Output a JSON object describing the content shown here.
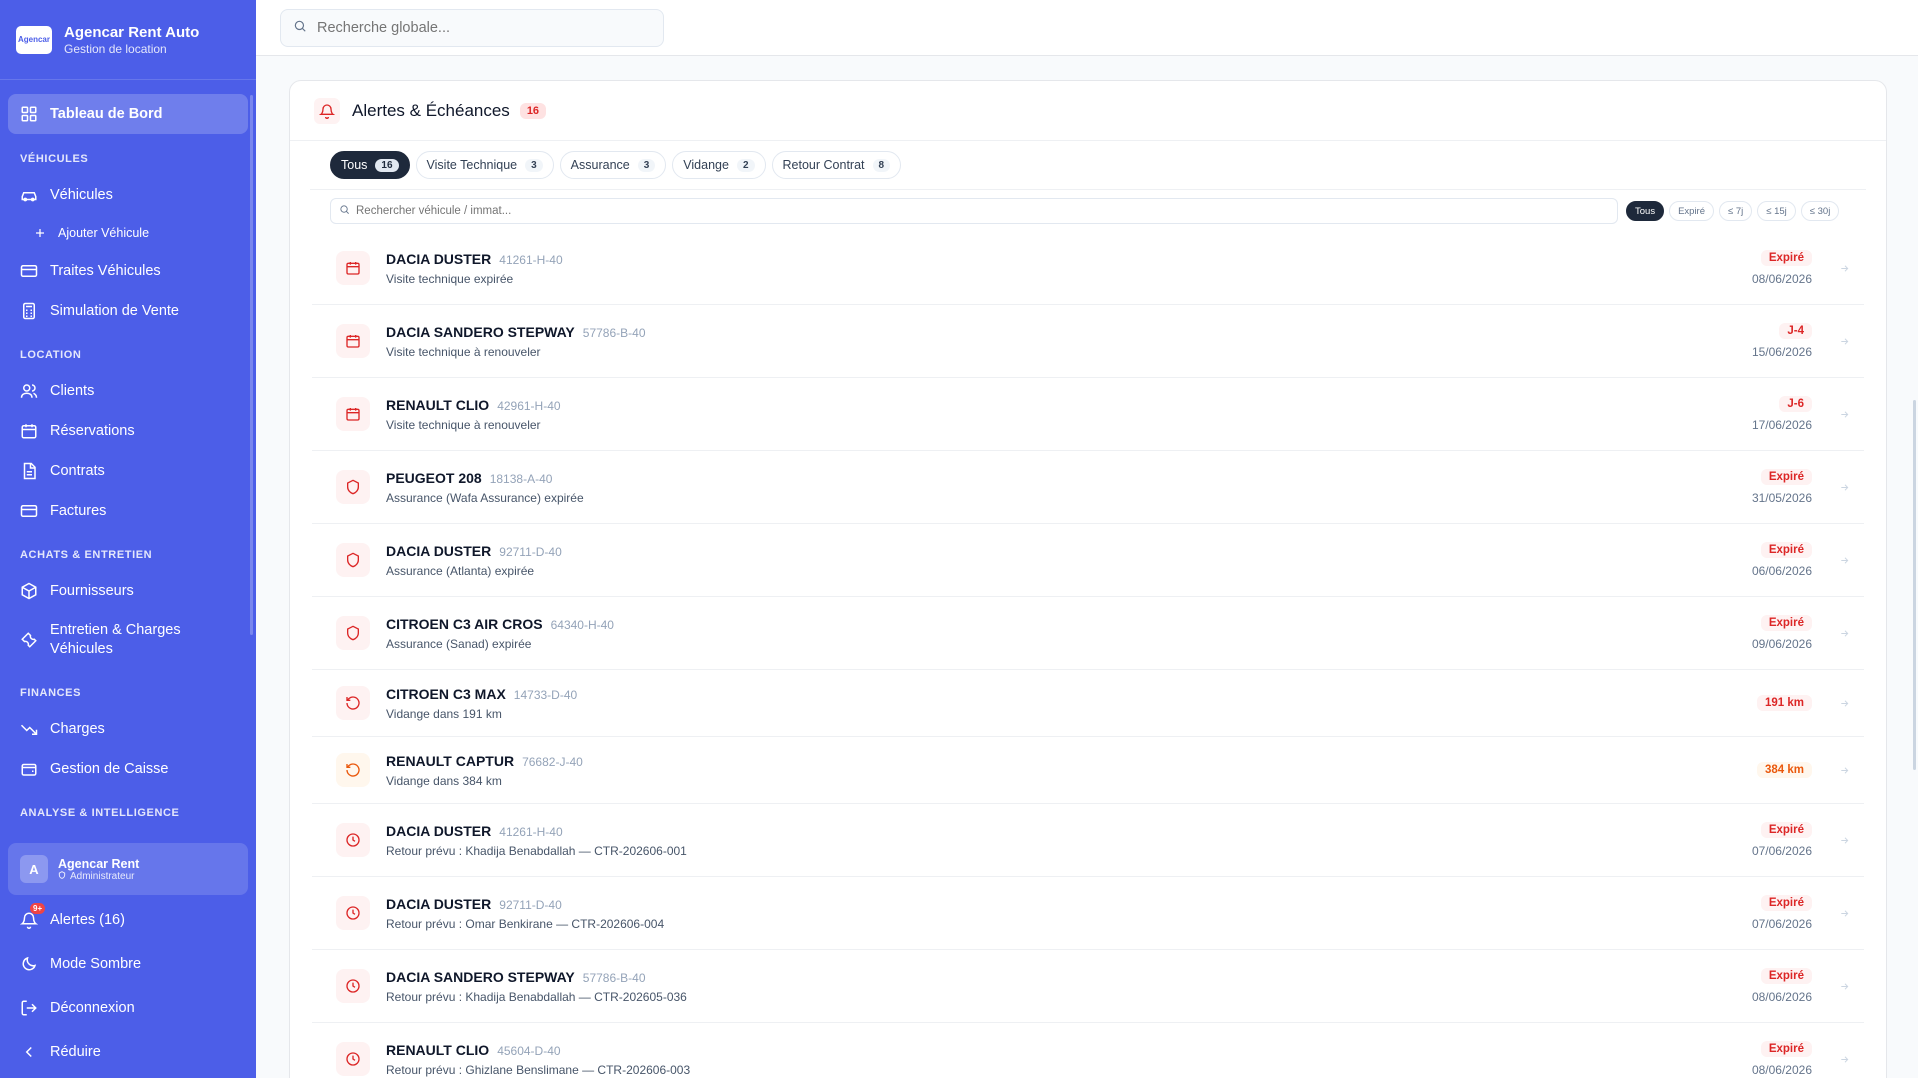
{
  "brand": {
    "title": "Agencar Rent Auto",
    "subtitle": "Gestion de location",
    "logo_text": "Agencar"
  },
  "sidebar": {
    "dashboard": "Tableau de Bord",
    "sections": {
      "vehicules": "VÉHICULES",
      "location": "LOCATION",
      "achats": "ACHATS & ENTRETIEN",
      "finances": "FINANCES",
      "analyse": "ANALYSE & INTELLIGENCE"
    },
    "items": {
      "vehicules": "Véhicules",
      "ajouter": "Ajouter Véhicule",
      "traites": "Traites Véhicules",
      "simulation": "Simulation de Vente",
      "clients": "Clients",
      "reservations": "Réservations",
      "contrats": "Contrats",
      "factures": "Factures",
      "fournisseurs": "Fournisseurs",
      "entretien": "Entretien & Charges Véhicules",
      "charges": "Charges",
      "caisse": "Gestion de Caisse"
    },
    "user": {
      "initial": "A",
      "name": "Agencar Rent",
      "role": "Administrateur"
    },
    "footer": {
      "alerts": "Alertes (16)",
      "alerts_badge": "9+",
      "dark_mode": "Mode Sombre",
      "logout": "Déconnexion",
      "collapse": "Réduire"
    }
  },
  "topbar": {
    "search_placeholder": "Recherche globale..."
  },
  "alerts_panel": {
    "title": "Alertes & Échéances",
    "count": "16",
    "tabs": [
      {
        "label": "Tous",
        "count": "16"
      },
      {
        "label": "Visite Technique",
        "count": "3"
      },
      {
        "label": "Assurance",
        "count": "3"
      },
      {
        "label": "Vidange",
        "count": "2"
      },
      {
        "label": "Retour Contrat",
        "count": "8"
      }
    ],
    "search_placeholder": "Rechercher véhicule / immat...",
    "chips": [
      "Tous",
      "Expiré",
      "≤ 7j",
      "≤ 15j",
      "≤ 30j"
    ],
    "items": [
      {
        "vehicle": "DACIA DUSTER",
        "plate": "41261-H-40",
        "desc": "Visite technique expirée",
        "status": "Expiré",
        "date": "08/06/2026"
      },
      {
        "vehicle": "DACIA SANDERO STEPWAY",
        "plate": "57786-B-40",
        "desc": "Visite technique à renouveler",
        "status": "J-4",
        "date": "15/06/2026"
      },
      {
        "vehicle": "RENAULT CLIO",
        "plate": "42961-H-40",
        "desc": "Visite technique à renouveler",
        "status": "J-6",
        "date": "17/06/2026"
      },
      {
        "vehicle": "PEUGEOT 208",
        "plate": "18138-A-40",
        "desc": "Assurance (Wafa Assurance) expirée",
        "status": "Expiré",
        "date": "31/05/2026"
      },
      {
        "vehicle": "DACIA DUSTER",
        "plate": "92711-D-40",
        "desc": "Assurance (Atlanta) expirée",
        "status": "Expiré",
        "date": "06/06/2026"
      },
      {
        "vehicle": "CITROEN C3 AIR CROS",
        "plate": "64340-H-40",
        "desc": "Assurance (Sanad) expirée",
        "status": "Expiré",
        "date": "09/06/2026"
      },
      {
        "vehicle": "CITROEN C3 MAX",
        "plate": "14733-D-40",
        "desc": "Vidange dans 191 km",
        "status": "191 km"
      },
      {
        "vehicle": "RENAULT CAPTUR",
        "plate": "76682-J-40",
        "desc": "Vidange dans 384 km",
        "status": "384 km"
      },
      {
        "vehicle": "DACIA DUSTER",
        "plate": "41261-H-40",
        "desc": "Retour prévu : Khadija Benabdallah — CTR-202606-001",
        "status": "Expiré",
        "date": "07/06/2026"
      },
      {
        "vehicle": "DACIA DUSTER",
        "plate": "92711-D-40",
        "desc": "Retour prévu : Omar Benkirane — CTR-202606-004",
        "status": "Expiré",
        "date": "07/06/2026"
      },
      {
        "vehicle": "DACIA SANDERO STEPWAY",
        "plate": "57786-B-40",
        "desc": "Retour prévu : Khadija Benabdallah — CTR-202605-036",
        "status": "Expiré",
        "date": "08/06/2026"
      },
      {
        "vehicle": "RENAULT CLIO",
        "plate": "45604-D-40",
        "desc": "Retour prévu : Ghizlane Benslimane — CTR-202606-003",
        "status": "Expiré",
        "date": "08/06/2026"
      }
    ]
  },
  "colors": {
    "sidebar_bg": "#4c5ee8",
    "danger": "#dc2626",
    "warning": "#ea580c",
    "active_tab": "#1e293b"
  }
}
